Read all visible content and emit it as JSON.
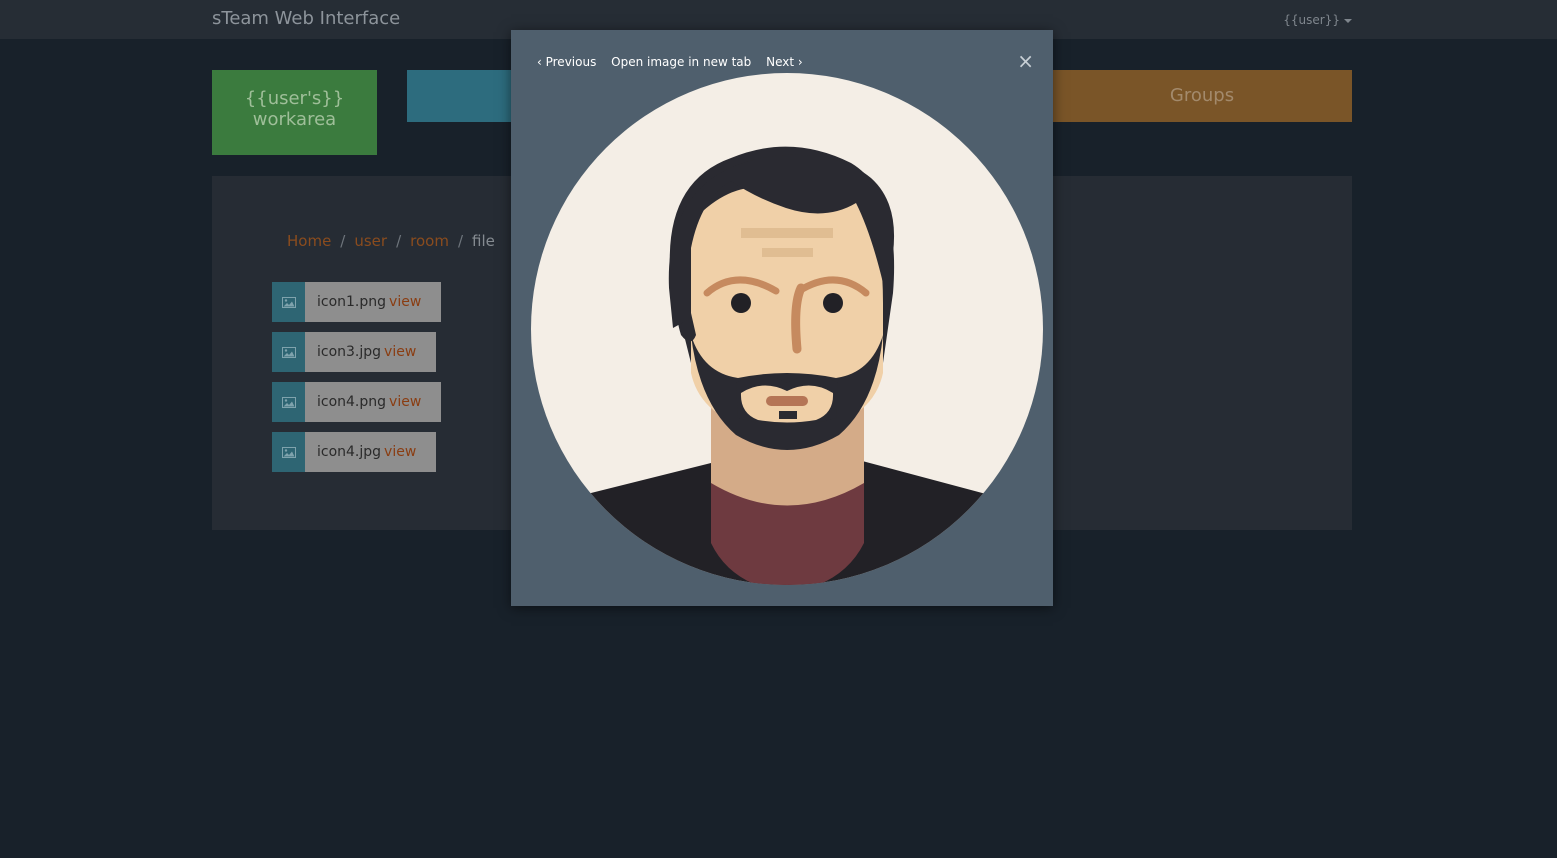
{
  "header": {
    "brand": "sTeam Web Interface",
    "user_menu": "{{user}}"
  },
  "tiles": {
    "workarea_line1": "{{user's}}",
    "workarea_line2": "workarea",
    "groups": "Groups"
  },
  "breadcrumb": {
    "items": [
      "Home",
      "user",
      "room"
    ],
    "separator": "/",
    "current": "file"
  },
  "files": [
    {
      "name": "icon1.png",
      "action": "view"
    },
    {
      "name": "icon3.jpg",
      "action": "view"
    },
    {
      "name": "icon4.png",
      "action": "view"
    },
    {
      "name": "icon4.jpg",
      "action": "view"
    }
  ],
  "lightbox": {
    "previous": "‹ Previous",
    "open_new_tab": "Open image in new tab",
    "next": "Next ›",
    "close": "×"
  },
  "colors": {
    "background": "#18212a",
    "navbar": "#262d35",
    "workarea_tile": "#3b7b3e",
    "groups_tile": "#7a5528",
    "modal": "#4f5f6d",
    "link": "#8a4c1e"
  }
}
